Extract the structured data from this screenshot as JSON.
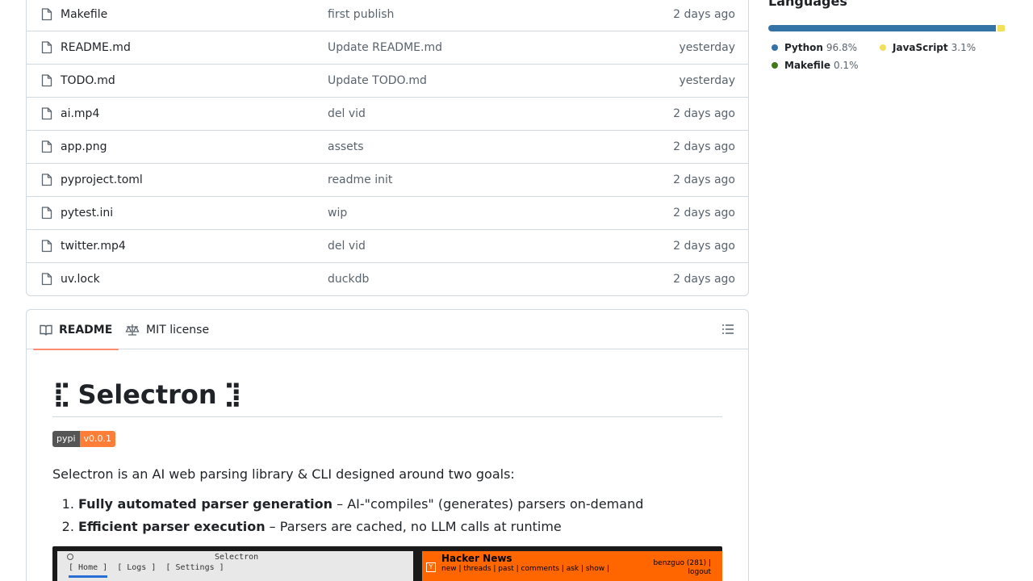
{
  "files": [
    {
      "name": "Makefile",
      "commit": "first publish",
      "date": "2 days ago"
    },
    {
      "name": "README.md",
      "commit": "Update README.md",
      "date": "yesterday"
    },
    {
      "name": "TODO.md",
      "commit": "Update TODO.md",
      "date": "yesterday"
    },
    {
      "name": "ai.mp4",
      "commit": "del vid",
      "date": "2 days ago"
    },
    {
      "name": "app.png",
      "commit": "assets",
      "date": "2 days ago"
    },
    {
      "name": "pyproject.toml",
      "commit": "readme init",
      "date": "2 days ago"
    },
    {
      "name": "pytest.ini",
      "commit": "wip",
      "date": "2 days ago"
    },
    {
      "name": "twitter.mp4",
      "commit": "del vid",
      "date": "2 days ago"
    },
    {
      "name": "uv.lock",
      "commit": "duckdb",
      "date": "2 days ago"
    }
  ],
  "readme": {
    "tabs": {
      "readme": "README",
      "license": "MIT license"
    },
    "title_prefix": "⣏",
    "title": "Selectron",
    "title_suffix": "⣹",
    "badge": {
      "left": "pypi",
      "right": "v0.0.1"
    },
    "intro": "Selectron is an AI web parsing library & CLI designed around two goals:",
    "goals": [
      {
        "bold": "Fully automated parser generation",
        "rest": " – AI-\"compiles\" (generates) parsers on-demand"
      },
      {
        "bold": "Efficient parser execution",
        "rest": " – Parsers are cached, no LLM calls at runtime"
      }
    ],
    "screenshot": {
      "app_title": "Selectron",
      "app_tabs": "[ Home ]  [ Logs ]  [ Settings ]",
      "hn_title": "Hacker News",
      "hn_nav": "new | threads | past | comments | ask | show |",
      "hn_user": "benzguo (281) |",
      "hn_logout": "logout",
      "hn_logo": "Y"
    }
  },
  "languages": {
    "title": "Languages",
    "items": [
      {
        "name": "Python",
        "pct": "96.8%",
        "value": 96.8,
        "color": "#3572A5"
      },
      {
        "name": "JavaScript",
        "pct": "3.1%",
        "value": 3.1,
        "color": "#f1e05a"
      },
      {
        "name": "Makefile",
        "pct": "0.1%",
        "value": 0.1,
        "color": "#427819"
      }
    ]
  }
}
